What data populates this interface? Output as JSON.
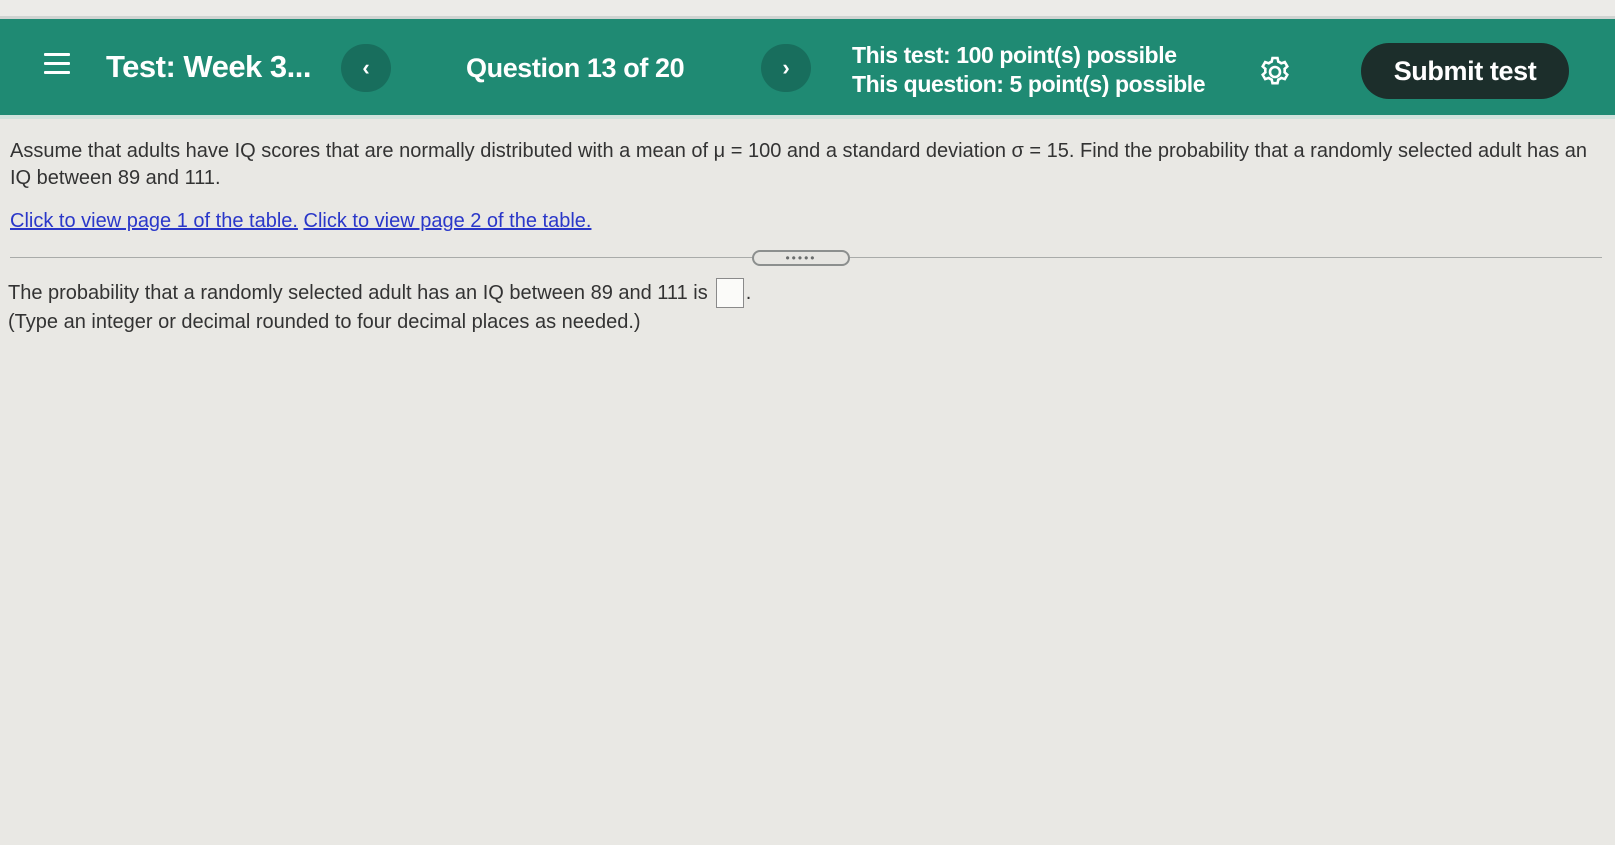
{
  "header": {
    "test_title": "Test:  Week 3...",
    "prev_label": "‹",
    "question_counter": "Question 13 of 20",
    "next_label": "›",
    "test_points": "This test: 100 point(s) possible",
    "question_points": "This question: 5 point(s) possible",
    "submit_label": "Submit test",
    "colors": {
      "bar": "#1f8a73",
      "submit": "#1c2e2b"
    },
    "icons": [
      "menu-icon",
      "gear-icon"
    ]
  },
  "question": {
    "prompt": "Assume that adults have IQ scores that are normally distributed with a mean of μ = 100 and a standard deviation σ = 15. Find the probability that a randomly selected adult has an IQ between 89 and 111.",
    "link_page1": "Click to view page 1 of the table.",
    "link_page2": "Click to view page 2 of the table.",
    "handle_label": "•••••",
    "answer_prefix": "The probability that a randomly selected adult has an IQ between 89 and 111 is",
    "answer_value": "",
    "answer_suffix": ".",
    "hint": "(Type an integer or decimal rounded to four decimal places as needed.)"
  }
}
